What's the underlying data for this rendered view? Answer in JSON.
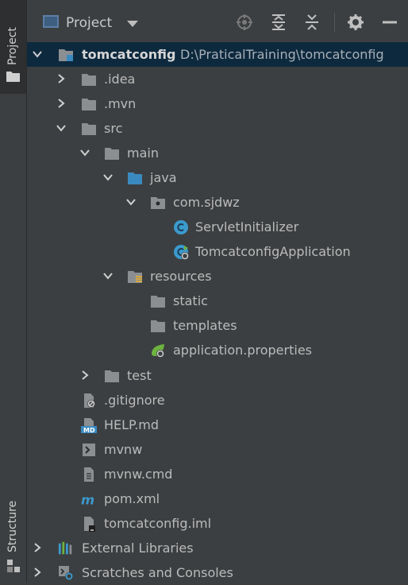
{
  "window": {
    "tool_strip": {
      "project_label": "Project",
      "structure_label": "Structure"
    },
    "header": {
      "view_label": "Project"
    }
  },
  "tree": {
    "root": {
      "label": "tomcatconfig",
      "path": "D:\\PraticalTraining\\tomcatconfig"
    },
    "items": [
      {
        "label": ".idea"
      },
      {
        "label": ".mvn"
      },
      {
        "label": "src"
      },
      {
        "label": "main"
      },
      {
        "label": "java"
      },
      {
        "label": "com.sjdwz"
      },
      {
        "label": "ServletInitializer"
      },
      {
        "label": "TomcatconfigApplication"
      },
      {
        "label": "resources"
      },
      {
        "label": "static"
      },
      {
        "label": "templates"
      },
      {
        "label": "application.properties"
      },
      {
        "label": "test"
      },
      {
        "label": ".gitignore"
      },
      {
        "label": "HELP.md"
      },
      {
        "label": "mvnw"
      },
      {
        "label": "mvnw.cmd"
      },
      {
        "label": "pom.xml"
      },
      {
        "label": "tomcatconfig.iml"
      },
      {
        "label": "External Libraries"
      },
      {
        "label": "Scratches and Consoles"
      }
    ]
  },
  "colors": {
    "panel_bg": "#3c3f41",
    "selection_bg": "#0d293e",
    "folder": "#8b8f92",
    "source_folder": "#3a8ac0",
    "class_icon": "#3b9acd",
    "spring_green": "#6db33f"
  },
  "icons": {
    "header": [
      "target-icon",
      "expand-all-icon",
      "collapse-all-icon",
      "gear-icon",
      "minimize-icon"
    ]
  }
}
